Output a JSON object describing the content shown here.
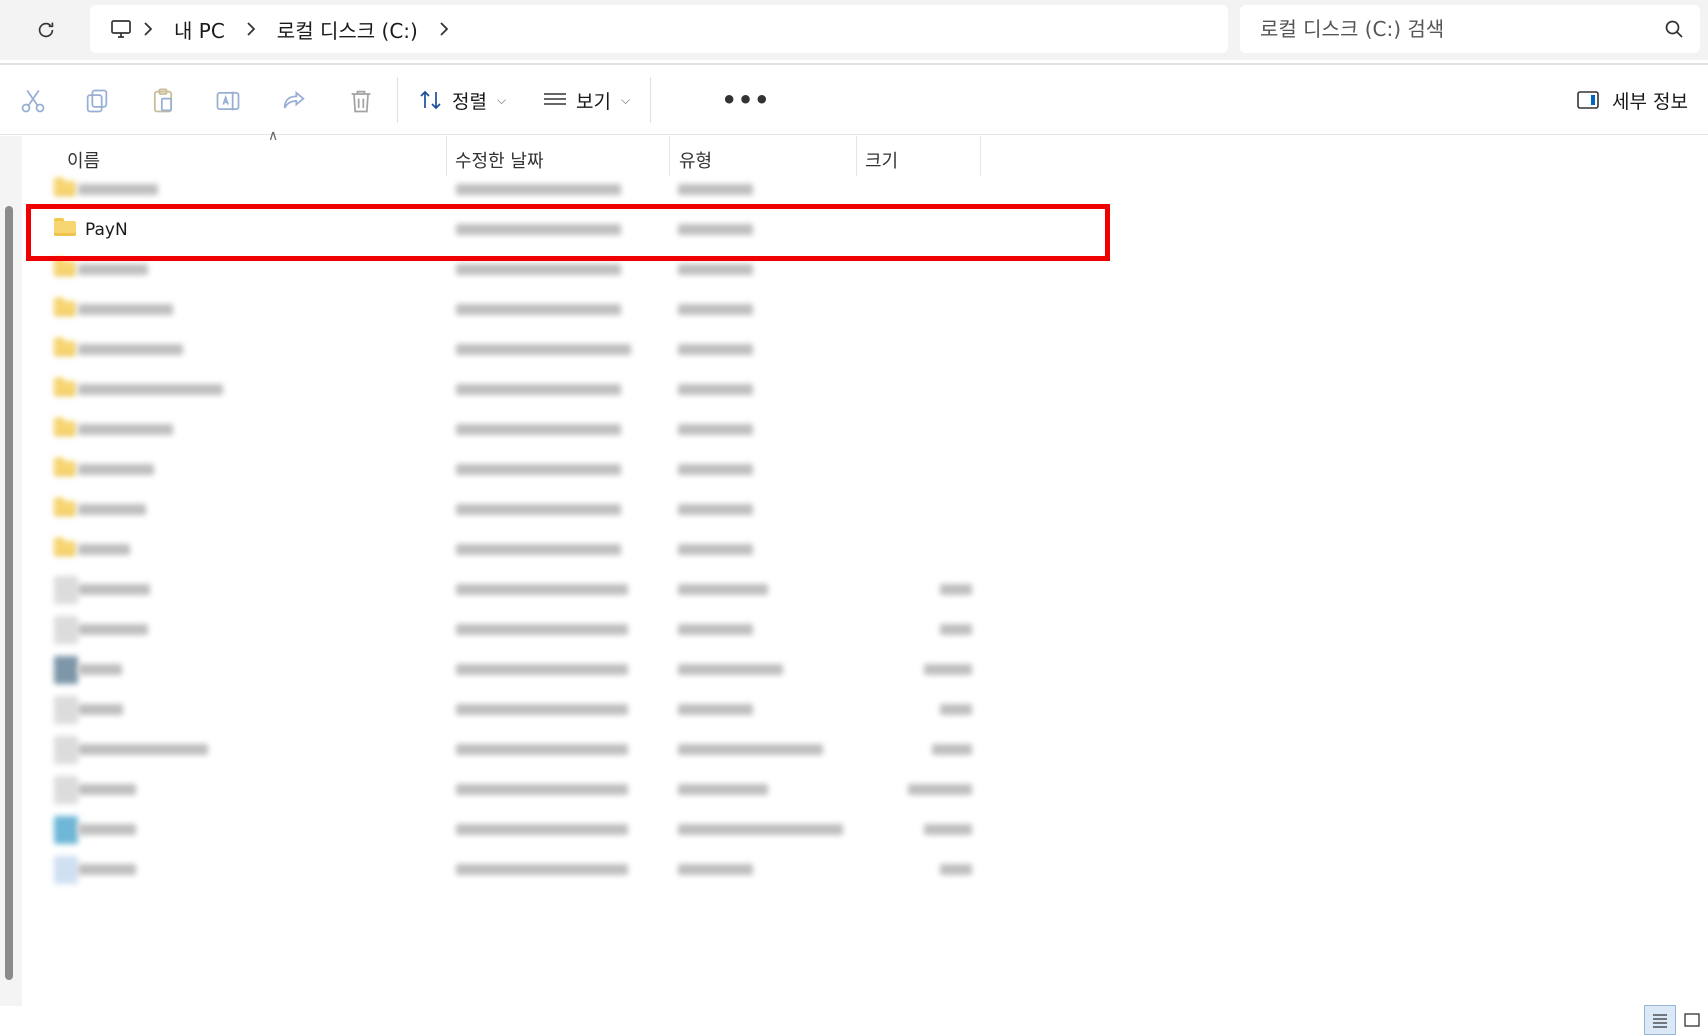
{
  "address_bar": {
    "breadcrumbs": [
      "내 PC",
      "로컬 디스크 (C:)"
    ],
    "search_placeholder": "로컬 디스크 (C:) 검색"
  },
  "toolbar": {
    "icons": [
      "cut-icon",
      "copy-icon",
      "paste-icon",
      "rename-icon",
      "share-icon",
      "delete-icon"
    ],
    "sort_label": "정렬",
    "view_label": "보기",
    "more_label": "•••",
    "details_label": "세부 정보"
  },
  "columns": {
    "name": "이름",
    "modified": "수정한 날짜",
    "type": "유형",
    "size": "크기"
  },
  "rows": [
    {
      "kind": "folder",
      "name": "",
      "blurred": true
    },
    {
      "kind": "folder",
      "name": "PayN",
      "blurred": false,
      "highlighted": true
    },
    {
      "kind": "folder",
      "name": "",
      "blurred": true
    },
    {
      "kind": "folder",
      "name": "",
      "blurred": true
    },
    {
      "kind": "folder",
      "name": "",
      "blurred": true
    },
    {
      "kind": "folder",
      "name": "",
      "blurred": true
    },
    {
      "kind": "folder",
      "name": "",
      "blurred": true
    },
    {
      "kind": "folder",
      "name": "",
      "blurred": true
    },
    {
      "kind": "folder",
      "name": "",
      "blurred": true
    },
    {
      "kind": "folder",
      "name": "",
      "blurred": true
    },
    {
      "kind": "file",
      "name": "",
      "blurred": true
    },
    {
      "kind": "file",
      "name": "",
      "blurred": true
    },
    {
      "kind": "file",
      "name": "",
      "blurred": true
    },
    {
      "kind": "file",
      "name": "",
      "blurred": true
    },
    {
      "kind": "file",
      "name": "",
      "blurred": true
    },
    {
      "kind": "file",
      "name": "",
      "blurred": true
    },
    {
      "kind": "file",
      "name": "",
      "blurred": true
    },
    {
      "kind": "file",
      "name": "",
      "blurred": true
    }
  ],
  "colors": {
    "highlight_border": "#ee0000",
    "accent": "#0067c0",
    "folder": "#f7d570"
  }
}
